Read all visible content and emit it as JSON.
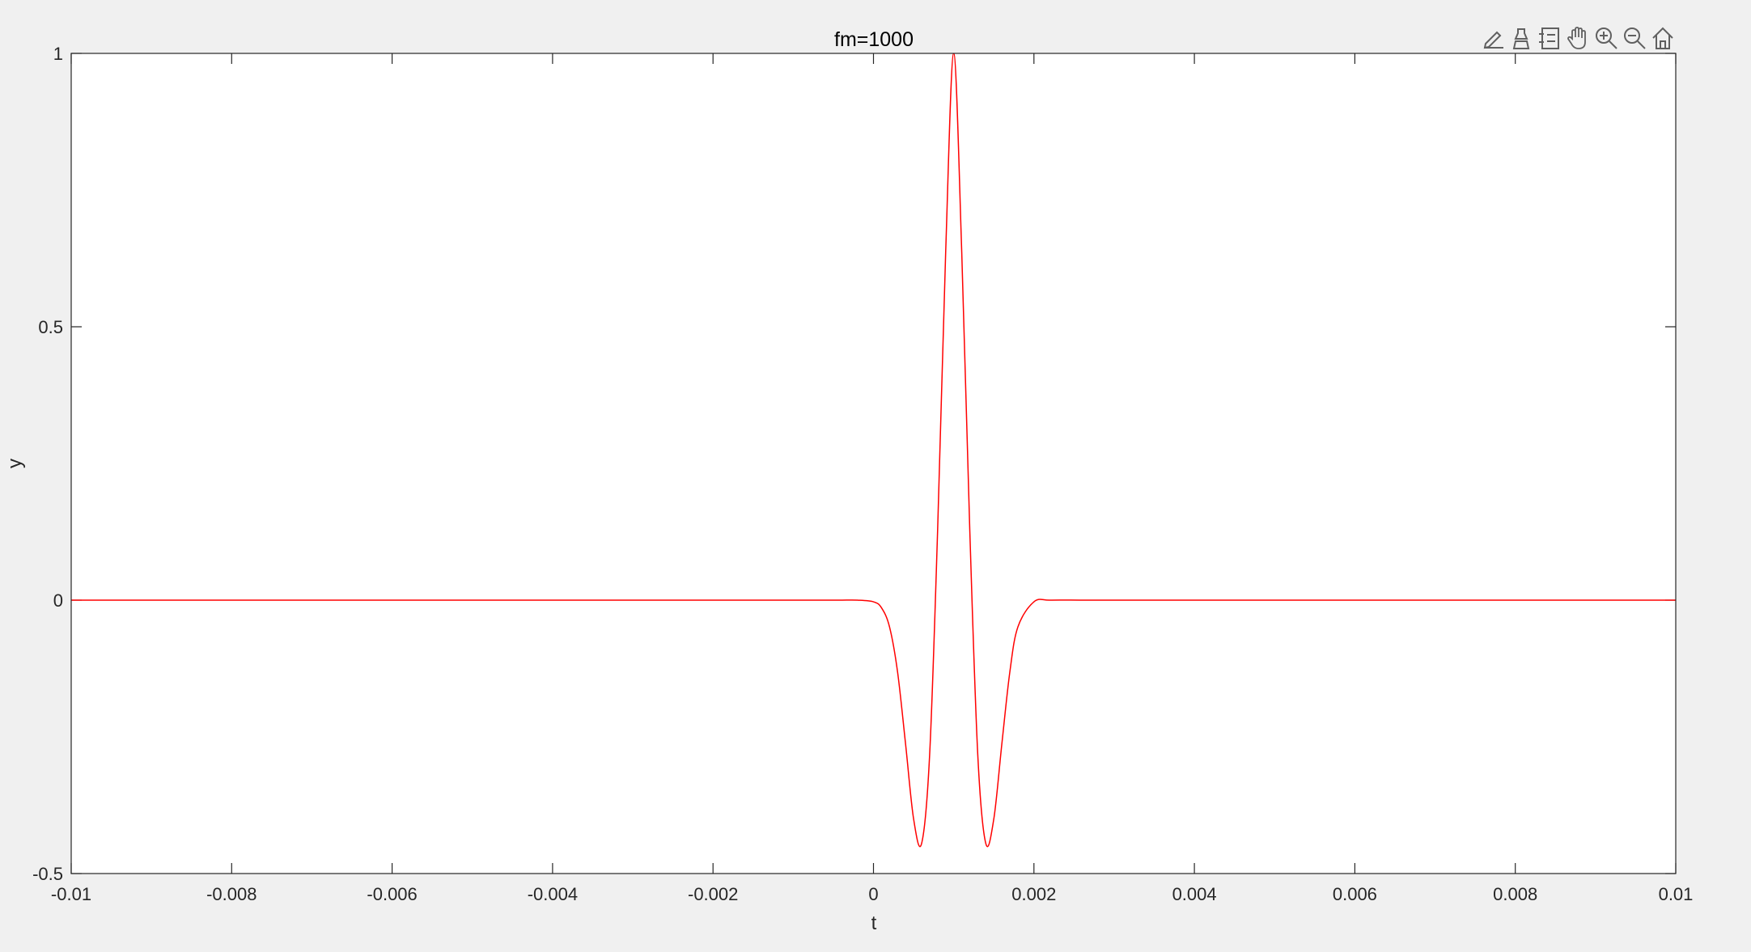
{
  "figure": {
    "background": "#f0f0f0",
    "axes_background": "#ffffff",
    "axis_color": "#262626",
    "line_color": "#ff0000"
  },
  "toolbar": {
    "icons": [
      "edit-plot-icon",
      "insert-data-tip-icon",
      "insert-legend-icon",
      "pan-hand-icon",
      "zoom-in-icon",
      "zoom-out-icon",
      "home-icon"
    ]
  },
  "chart_data": {
    "type": "line",
    "title": "fm=1000",
    "xlabel": "t",
    "ylabel": "y",
    "xlim": [
      -0.01,
      0.01
    ],
    "ylim": [
      -0.5,
      1
    ],
    "xticks": [
      -0.01,
      -0.008,
      -0.006,
      -0.004,
      -0.002,
      0,
      0.002,
      0.004,
      0.006,
      0.008,
      0.01
    ],
    "xtick_labels": [
      "-0.01",
      "-0.008",
      "-0.006",
      "-0.004",
      "-0.002",
      "0",
      "0.002",
      "0.004",
      "0.006",
      "0.008",
      "0.01"
    ],
    "yticks": [
      -0.5,
      0,
      0.5,
      1
    ],
    "ytick_labels": [
      "-0.5",
      "0",
      "0.5",
      "1"
    ],
    "grid": false,
    "series": [
      {
        "color": "#ff0000",
        "x": [
          -0.01,
          -0.005,
          -0.001,
          -0.0006,
          -0.0004,
          -0.0002,
          0,
          0.0001,
          0.0002,
          0.0003,
          0.0004,
          0.0005,
          0.0006,
          0.0007,
          0.0008,
          0.0009,
          0.001,
          0.0011,
          0.0012,
          0.0013,
          0.0014,
          0.0015,
          0.0016,
          0.0017,
          0.0018,
          0.002,
          0.0022,
          0.0026,
          0.003,
          0.005,
          0.01
        ],
        "y": [
          0,
          0,
          0,
          0,
          0,
          0,
          -0.003,
          -0.014,
          -0.049,
          -0.131,
          -0.263,
          -0.4,
          -0.445,
          -0.283,
          0.13,
          0.637,
          1,
          0.637,
          0.13,
          -0.283,
          -0.445,
          -0.4,
          -0.263,
          -0.131,
          -0.049,
          -0.003,
          0,
          0,
          0,
          0,
          0
        ]
      }
    ]
  }
}
